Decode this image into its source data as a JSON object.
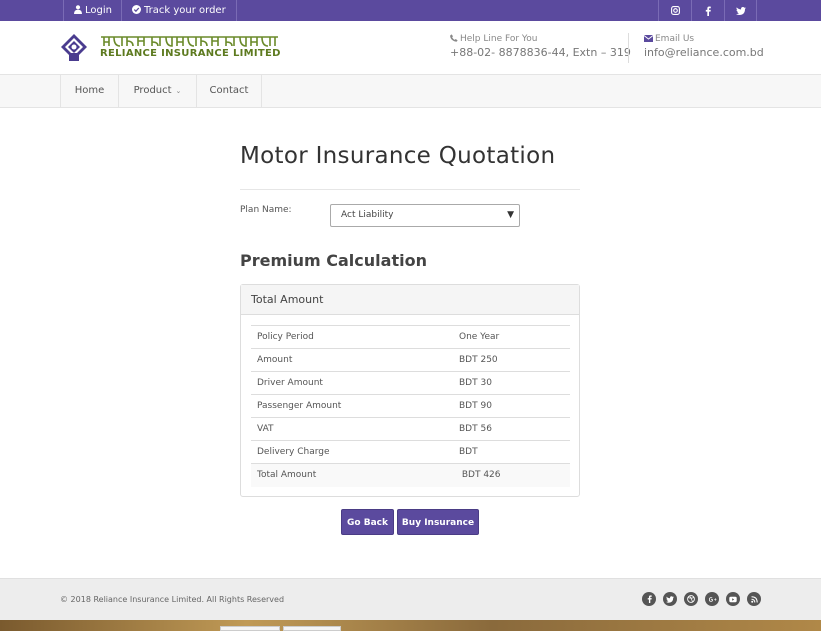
{
  "topbar": {
    "login_label": "Login",
    "track_label": "Track your order",
    "social": [
      "instagram-icon",
      "facebook-icon",
      "twitter-icon"
    ]
  },
  "header": {
    "logo_bengali": "রিলায়েন্স ইন্স্যুরেন্স লিমিটেড",
    "logo_english": "RELIANCE INSURANCE LIMITED",
    "help_label": "Help Line For You",
    "help_value": "+88-02- 8878836-44, Extn – 319",
    "email_label": "Email Us",
    "email_value": "info@reliance.com.bd"
  },
  "nav": {
    "home": "Home",
    "product": "Product",
    "contact": "Contact"
  },
  "main": {
    "title": "Motor Insurance Quotation",
    "plan_label": "Plan Name:",
    "plan_value": "Act Liability",
    "section_title": "Premium Calculation",
    "panel_title": "Total Amount",
    "rows": [
      {
        "label": "Policy Period",
        "value": "One Year"
      },
      {
        "label": "Amount",
        "value": "BDT  250"
      },
      {
        "label": "Driver Amount",
        "value": "BDT  30"
      },
      {
        "label": "Passenger Amount",
        "value": "BDT 90"
      },
      {
        "label": "VAT",
        "value": "BDT 56"
      },
      {
        "label": "Delivery Charge",
        "value": "BDT"
      },
      {
        "label": "Total Amount",
        "value": " BDT 426"
      }
    ],
    "back_label": "Go Back",
    "buy_label": "Buy Insurance"
  },
  "footer": {
    "copyright": "© 2018 Reliance Insurance Limited. All Rights Reserved",
    "icons": [
      "facebook-icon",
      "twitter-icon",
      "dribbble-icon",
      "google-plus-icon",
      "youtube-icon",
      "rss-icon"
    ]
  },
  "colors": {
    "brand_purple": "#5b4a9e",
    "logo_green": "#6a8a2a"
  }
}
